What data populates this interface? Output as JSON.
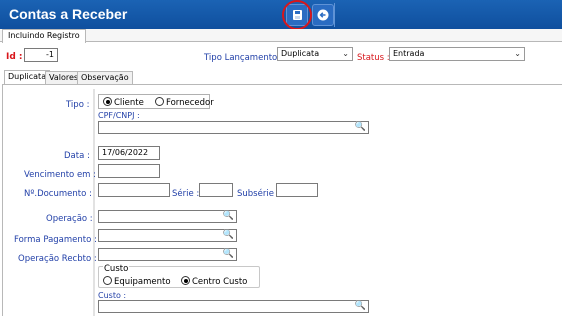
{
  "window": {
    "title": "Contas a Receber"
  },
  "toolbar": {
    "save_icon": "save-icon",
    "back_icon": "back-icon"
  },
  "outer_tab": {
    "label": "Incluindo Registro"
  },
  "header": {
    "id_label": "Id :",
    "id_value": "-1",
    "tipo_lancamento_label": "Tipo Lançamento :",
    "tipo_lancamento_value": "Duplicata",
    "status_label": "Status :",
    "status_value": "Entrada"
  },
  "tabs": [
    {
      "label": "Duplicata"
    },
    {
      "label": "Valores"
    },
    {
      "label": "Observação"
    }
  ],
  "form": {
    "tipo_label": "Tipo :",
    "tipo_options": [
      "Cliente",
      "Fornecedor"
    ],
    "cpf_cnpj_label": "CPF/CNPJ :",
    "cpf_cnpj_value": "",
    "data_label": "Data :",
    "data_value": "17/06/2022",
    "vencimento_label": "Vencimento em :",
    "vencimento_value": "",
    "documento_label": "Nº.Documento :",
    "documento_value": "",
    "serie_label": "Série :",
    "serie_value": "",
    "subserie_label": "Subsérie :",
    "subserie_value": "",
    "operacao_label": "Operação :",
    "forma_pagamento_label": "Forma Pagamento :",
    "operacao_recbto_label": "Operação Recbto :",
    "custo_group_label": "Custo",
    "custo_options": [
      "Equipamento",
      "Centro Custo"
    ],
    "custo_label": "Custo :"
  }
}
